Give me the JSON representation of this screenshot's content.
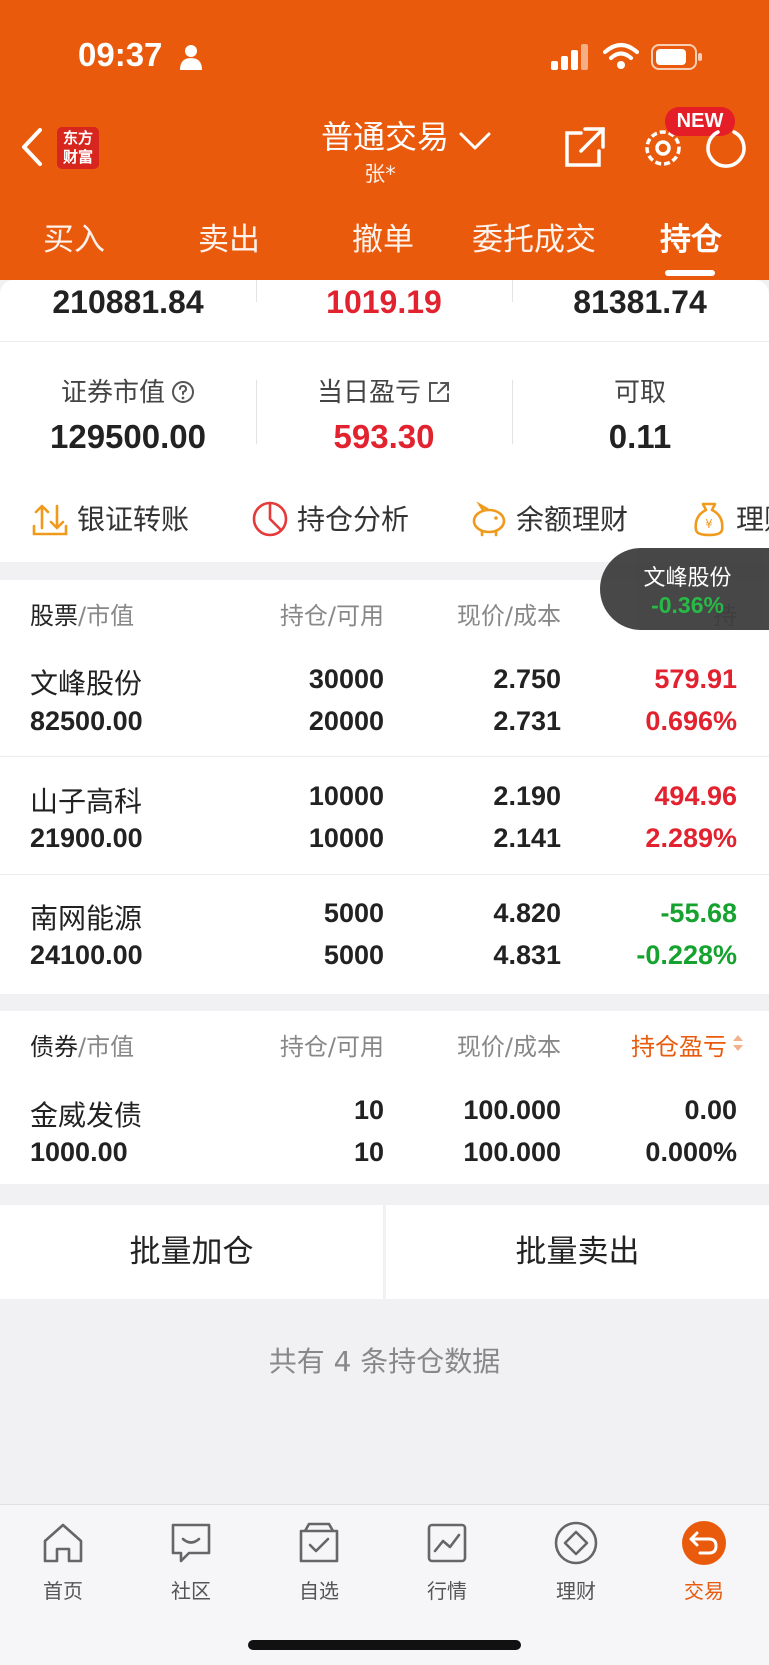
{
  "status_bar": {
    "time": "09:37"
  },
  "header": {
    "logo_text_line1": "东方",
    "logo_text_line2": "财富",
    "title": "普通交易",
    "subtitle": "张*",
    "new_badge": "NEW"
  },
  "tabs": [
    {
      "label": "买入"
    },
    {
      "label": "卖出"
    },
    {
      "label": "撤单"
    },
    {
      "label": "委托成交"
    },
    {
      "label": "持仓",
      "active": true
    }
  ],
  "summary_top": {
    "total_assets": "210881.84",
    "total_pnl": "1019.19",
    "available": "81381.74"
  },
  "summary_mid": {
    "market_value_label": "证券市值",
    "market_value": "129500.00",
    "daily_pnl_label": "当日盈亏",
    "daily_pnl": "593.30",
    "withdrawable_label": "可取",
    "withdrawable": "0.11"
  },
  "actions": [
    {
      "label": "银证转账",
      "icon": "transfer-icon"
    },
    {
      "label": "持仓分析",
      "icon": "pie-chart-icon"
    },
    {
      "label": "余额理财",
      "icon": "piggy-bank-icon"
    },
    {
      "label": "理财",
      "icon": "money-bag-icon"
    }
  ],
  "stocks_header": {
    "col1_main": "股票",
    "col1_sub": "/市值",
    "col2": "持仓/可用",
    "col3": "现价/成本",
    "col4": "持"
  },
  "stocks": [
    {
      "name": "文峰股份",
      "market_value": "82500.00",
      "holding": "30000",
      "available": "20000",
      "price": "2.750",
      "cost": "2.731",
      "pnl": "579.91",
      "pnl_pct": "0.696%"
    },
    {
      "name": "山子高科",
      "market_value": "21900.00",
      "holding": "10000",
      "available": "10000",
      "price": "2.190",
      "cost": "2.141",
      "pnl": "494.96",
      "pnl_pct": "2.289%"
    },
    {
      "name": "南网能源",
      "market_value": "24100.00",
      "holding": "5000",
      "available": "5000",
      "price": "4.820",
      "cost": "4.831",
      "pnl": "-55.68",
      "pnl_pct": "-0.228%"
    }
  ],
  "tooltip": {
    "name": "文峰股份",
    "change": "-0.36%"
  },
  "bonds_header": {
    "col1_main": "债券",
    "col1_sub": "/市值",
    "col2": "持仓/可用",
    "col3": "现价/成本",
    "col4": "持仓盈亏"
  },
  "bonds": [
    {
      "name": "金威发债",
      "market_value": "1000.00",
      "holding": "10",
      "available": "10",
      "price": "100.000",
      "cost": "100.000",
      "pnl": "0.00",
      "pnl_pct": "0.000%"
    }
  ],
  "batch_add_label": "批量加仓",
  "batch_sell_label": "批量卖出",
  "summary_text": "共有 4 条持仓数据",
  "bottom_nav": [
    {
      "label": "首页",
      "icon": "home-icon"
    },
    {
      "label": "社区",
      "icon": "chat-icon"
    },
    {
      "label": "自选",
      "icon": "watchlist-icon"
    },
    {
      "label": "行情",
      "icon": "market-chart-icon"
    },
    {
      "label": "理财",
      "icon": "diamond-icon"
    },
    {
      "label": "交易",
      "icon": "trade-icon",
      "active": true
    }
  ],
  "colors": {
    "brand": "#ea5a0c",
    "up": "#e2222f",
    "down": "#16a22f",
    "badge": "#e41d26"
  }
}
